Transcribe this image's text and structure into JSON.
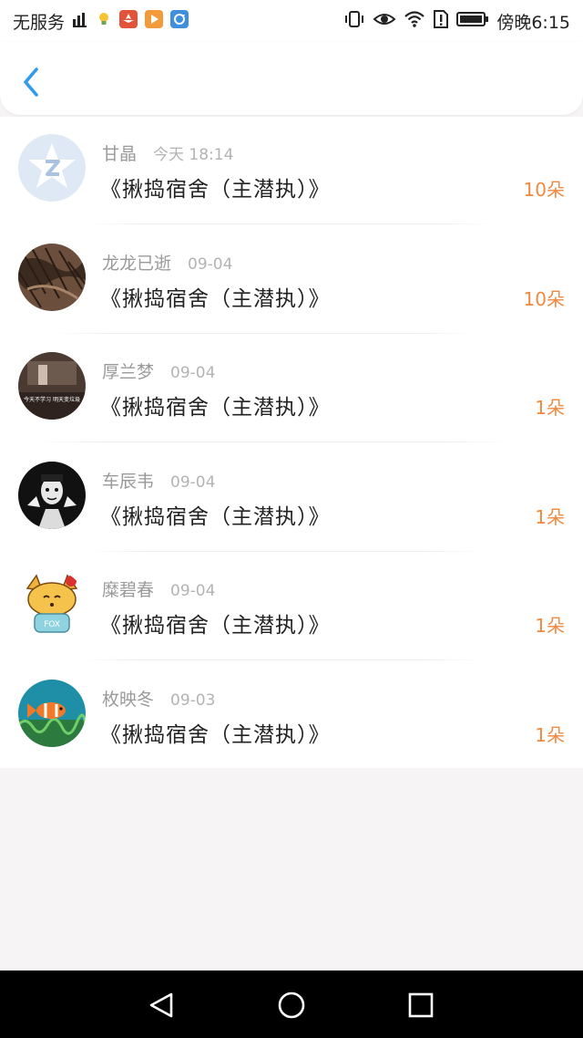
{
  "status_bar": {
    "carrier": "无服务",
    "clock": "傍晚6:15",
    "icons": [
      "signal-icon",
      "lightbulb-icon",
      "huawei-icon",
      "play-icon",
      "sync-icon",
      "vibrate-icon",
      "eye-icon",
      "wifi-icon",
      "sim-alert-icon",
      "battery-icon"
    ]
  },
  "header": {
    "back_icon": "chevron-left-icon",
    "accent_color": "#2f9bef"
  },
  "gifts": [
    {
      "name": "甘晶",
      "time": "今天 18:14",
      "title": "《揪捣宿舍（主潜执）》",
      "count": "10朵",
      "avatar": "qq-default-avatar"
    },
    {
      "name": "龙龙已逝",
      "time": "09-04",
      "title": "《揪捣宿舍（主潜执）》",
      "count": "10朵",
      "avatar": "hair-avatar"
    },
    {
      "name": "厚兰梦",
      "time": "09-04",
      "title": "《揪捣宿舍（主潜执）》",
      "count": "1朵",
      "avatar": "caption-avatar",
      "avatar_text": "今天不学习 明天变垃圾"
    },
    {
      "name": "车辰韦",
      "time": "09-04",
      "title": "《揪捣宿舍（主潜执）》",
      "count": "1朵",
      "avatar": "mime-avatar"
    },
    {
      "name": "糜碧春",
      "time": "09-04",
      "title": "《揪捣宿舍（主潜执）》",
      "count": "1朵",
      "avatar": "fox-avatar",
      "avatar_text": "FOX"
    },
    {
      "name": "枚映冬",
      "time": "09-03",
      "title": "《揪捣宿舍（主潜执）》",
      "count": "1朵",
      "avatar": "clownfish-avatar"
    }
  ],
  "colors": {
    "count": "#f0883e",
    "name": "#9a9a9a",
    "time": "#b3b3b3",
    "page_background": "#f6f4f5"
  },
  "nav_bar": {
    "icons": [
      "back-triangle-icon",
      "home-circle-icon",
      "recents-square-icon"
    ]
  }
}
